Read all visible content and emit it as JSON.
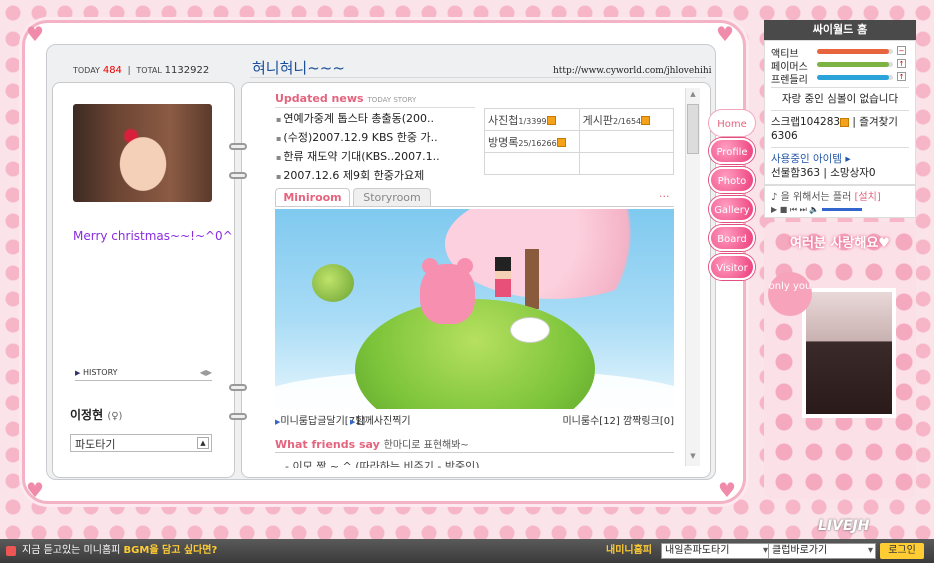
{
  "counter": {
    "today_label": "TODAY",
    "today": "484",
    "total_label": "TOTAL",
    "total": "1132922"
  },
  "title": "혀니혀니~~~",
  "url": "http://www.cyworld.com/jhlovehihi",
  "profile": {
    "message": "Merry christmas~~!~^0^",
    "history_label": "HISTORY",
    "name": "이정현",
    "gender": "(♀)",
    "mood": "파도타기"
  },
  "updated": {
    "title": "Updated news",
    "sub": "TODAY STORY",
    "items": [
      "연예가중계 톱스타 총출동(200..",
      "(수정)2007.12.9 KBS 한중 가..",
      "한류 재도약 기대(KBS..2007.1..",
      "2007.12.6 제9회 한중가요제"
    ]
  },
  "boards": [
    {
      "label": "사진첩",
      "count": "1/3399"
    },
    {
      "label": "게시판",
      "count": "2/1654"
    },
    {
      "label": "방명록",
      "count": "25/16266"
    },
    {
      "label": "",
      "count": ""
    }
  ],
  "tabs": {
    "active": "Miniroom",
    "inactive": "Storyroom",
    "more": "···"
  },
  "miniroom": {
    "reply": "미니룸답글달기",
    "reply_count": "[71]",
    "photo": "함께사진찍기",
    "room_count_label": "미니룸수",
    "room_count": "[12]",
    "link_label": "깜짝링크",
    "link_count": "[0]"
  },
  "friends": {
    "title": "What friends say",
    "sub": "한마디로 표현해봐~",
    "first": "- 이모 짱 ~ ^ (따라하는 비주기 - 박중인)"
  },
  "nav": [
    "Home",
    "Profile",
    "Photo",
    "Gallery",
    "Board",
    "Visitor"
  ],
  "right": {
    "header": "싸이월드 홈",
    "bars": [
      {
        "label": "액티브",
        "color": "#e8643c",
        "fraction": 0.95,
        "sign": "−"
      },
      {
        "label": "페이머스",
        "color": "#7cb342",
        "fraction": 0.95,
        "sign": "↑"
      },
      {
        "label": "프렌들리",
        "color": "#29a3d8",
        "fraction": 0.95,
        "sign": "↑"
      }
    ],
    "proud": "자랑 중인 심볼이 없습니다",
    "scrap_label": "스크랩",
    "scrap": "104283",
    "fav_label": "즐겨찾기",
    "fav": "6306",
    "items": "사용중인 아이템",
    "gift_label": "선물함",
    "gift": "363",
    "wish_label": "소망상자",
    "wish": "0"
  },
  "bgm": {
    "text": "을 위해서는 플러",
    "setup": "[설치]"
  },
  "friendcard": {
    "text": "여러분 사랑해요♥",
    "badge": "only you"
  },
  "status": {
    "message_pre": "지금 듣고있는 미니홈피 ",
    "message_bold": "BGM을 담고 싶다면?",
    "myhome": "내미니홈피",
    "select1": "내일촌파도타기",
    "select2": "클럽바로가기",
    "logout": "로그인"
  },
  "watermark": "LIVEJH"
}
